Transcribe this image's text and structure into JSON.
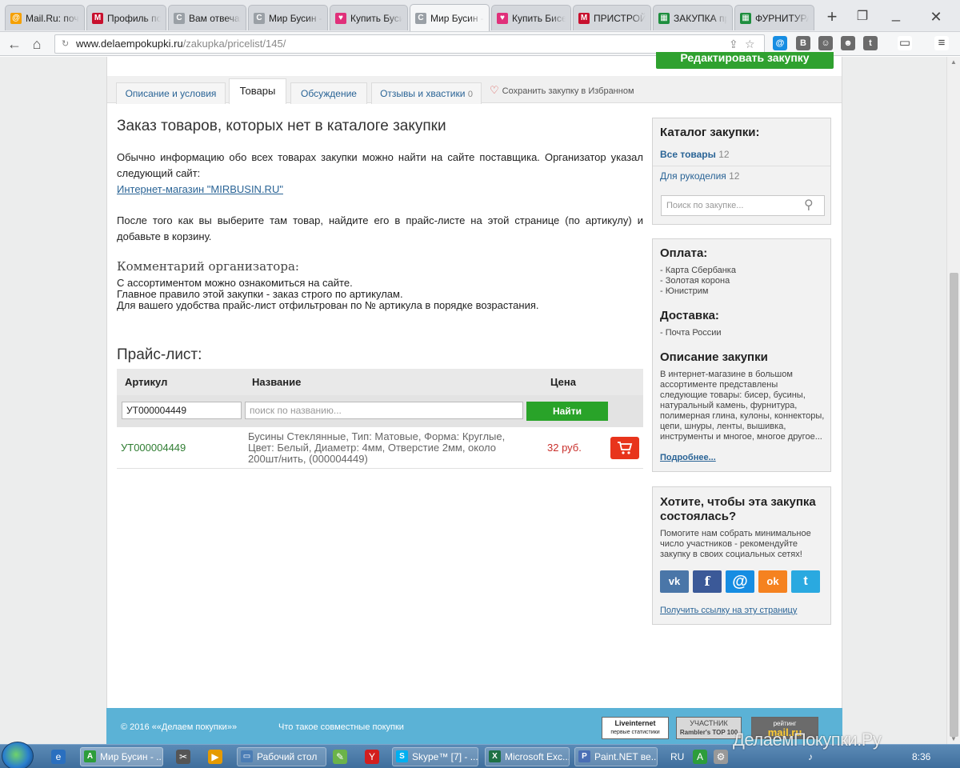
{
  "browser": {
    "tabs": [
      {
        "title": "Mail.Ru: почт",
        "fav": "@",
        "fav_color": "#f5a000"
      },
      {
        "title": "Профиль пол",
        "fav": "M",
        "fav_color": "#c8102e"
      },
      {
        "title": "Вам отвечак",
        "fav": "C",
        "fav_color": "#9aa0a6"
      },
      {
        "title": "Мир Бусин -",
        "fav": "C",
        "fav_color": "#9aa0a6"
      },
      {
        "title": "Купить Бусин",
        "fav": "♥",
        "fav_color": "#e0307a"
      },
      {
        "title": "Мир Бусин -",
        "fav": "C",
        "fav_color": "#9aa0a6"
      },
      {
        "title": "Купить Бисер",
        "fav": "♥",
        "fav_color": "#e0307a"
      },
      {
        "title": "ПРИСТРОЙ",
        "fav": "M",
        "fav_color": "#c8102e"
      },
      {
        "title": "ЗАКУПКА пр",
        "fav": "▦",
        "fav_color": "#1e8e3e"
      },
      {
        "title": "ФУРНИТУРА",
        "fav": "▦",
        "fav_color": "#1e8e3e"
      }
    ],
    "url_domain": "www.delaempokupki.ru",
    "url_path": "/zakupka/pricelist/145/"
  },
  "page": {
    "edit_button": "Редактировать закупку",
    "tabs": [
      {
        "label": "Описание и условия"
      },
      {
        "label": "Товары"
      },
      {
        "label": "Обсуждение"
      },
      {
        "label": "Отзывы и хвастики",
        "count": "0"
      }
    ],
    "save_favorite": "Сохранить закупку в Избранном",
    "heading": "Заказ товаров, которых нет в каталоге закупки",
    "intro": "Обычно информацию обо всех товарах закупки можно найти на сайте поставщика. Организатор указал следующий сайт:",
    "supplier_link": "Интернет-магазин \"MIRBUSIN.RU\"",
    "instruction": "После того как вы выберите там товар, найдите его в прайс-листе на этой странице (по артикулу) и добавьте в корзину.",
    "comment_heading": "Комментарий организатора:",
    "comment_lines": [
      "С ассортиментом можно ознакомиться на сайте.",
      "Главное правило этой закупки - заказ строго по артикулам.",
      "Для вашего удобства прайс-лист отфильтрован по № артикула в порядке возрастания."
    ],
    "pricelist_heading": "Прайс-лист:",
    "table": {
      "headers": {
        "sku": "Артикул",
        "name": "Название",
        "price": "Цена"
      },
      "filter": {
        "sku_value": "УТ000004449",
        "name_placeholder": "поиск по названию...",
        "find_button": "Найти"
      },
      "rows": [
        {
          "sku": "УТ000004449",
          "name": "Бусины Стеклянные, Тип: Матовые, Форма: Круглые, Цвет: Белый, Диаметр: 4мм, Отверстие 2мм, около 200шт/нить, (000004449)",
          "price": "32 руб."
        }
      ]
    }
  },
  "sidebar": {
    "catalog": {
      "title": "Каталог закупки:",
      "all_label": "Все товары",
      "all_count": "12",
      "cat_label": "Для рукоделия",
      "cat_count": "12",
      "search_placeholder": "Поиск по закупке..."
    },
    "payment": {
      "title": "Оплата:",
      "items": [
        "- Карта Сбербанка",
        "- Золотая корона",
        "- Юнистрим"
      ]
    },
    "delivery": {
      "title": "Доставка:",
      "items": [
        "- Почта России"
      ]
    },
    "description": {
      "title": "Описание закупки",
      "text": "В интернет-магазине в большом ассортименте представлены следующие товары: бисер, бусины, натуральный камень, фурнитура, полимерная глина, кулоны, коннекторы, цепи, шнуры, ленты, вышивка, инструменты и многое, многое другое...",
      "more": "Подробнее..."
    },
    "share": {
      "title": "Хотите, чтобы эта закупка состоялась?",
      "text": "Помогите нам собрать минимальное число участников - рекомендуйте закупку в своих социальных сетях!",
      "link": "Получить ссылку на эту страницу",
      "networks": [
        {
          "name": "vk",
          "glyph": "vk",
          "color": "#4a76a8"
        },
        {
          "name": "facebook",
          "glyph": "f",
          "color": "#3b5998"
        },
        {
          "name": "mailru",
          "glyph": "@",
          "color": "#168de2"
        },
        {
          "name": "odnoklassniki",
          "glyph": "ok",
          "color": "#f58220"
        },
        {
          "name": "twitter",
          "glyph": "t",
          "color": "#2aa9e0"
        }
      ]
    }
  },
  "footer": {
    "copyright": "© 2016 ««Делаем покупки»»",
    "what_link": "Что такое совместные покупки",
    "counters": [
      {
        "top": "Liveinternet",
        "bottom": "первые статистики"
      },
      {
        "top": "УЧАСТНИК",
        "bottom": "Rambler's TOP 100"
      },
      {
        "top": "рейтинг",
        "bottom": "mail.ru"
      }
    ]
  },
  "taskbar": {
    "items": [
      {
        "label": "Мир Бусин - ...",
        "icon": "A",
        "icon_color": "#2d9d3b",
        "active": true
      },
      {
        "label": "Рабочий стол",
        "icon": "▭",
        "icon_color": "#4b7db5"
      },
      {
        "label": "Skype™ [7] - ...",
        "icon": "S",
        "icon_color": "#00aff0"
      },
      {
        "label": "Microsoft Exc...",
        "icon": "X",
        "icon_color": "#1e7145"
      },
      {
        "label": "Paint.NET ве...",
        "icon": "P",
        "icon_color": "#4a6fb5"
      }
    ],
    "lang": "RU",
    "time": "8:36"
  },
  "watermark": "ДелаемПокупки.Ру",
  "colors": {
    "green": "#2fa12f",
    "link": "#2a6496",
    "price": "#c9302c",
    "footer": "#5bb2d6"
  }
}
